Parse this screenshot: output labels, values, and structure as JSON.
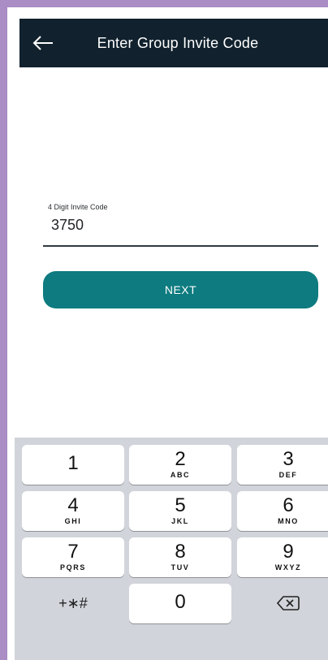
{
  "header": {
    "title": "Enter Group Invite Code",
    "back_icon": "arrow-left-icon",
    "background": "#11222e"
  },
  "invite": {
    "label": "4 Digit Invite Code",
    "value": "3750"
  },
  "next_button": {
    "label": "NEXT",
    "color": "#0d7b7f"
  },
  "keypad": {
    "keys": [
      {
        "digit": "1",
        "letters": ""
      },
      {
        "digit": "2",
        "letters": "ABC"
      },
      {
        "digit": "3",
        "letters": "DEF"
      },
      {
        "digit": "4",
        "letters": "GHI"
      },
      {
        "digit": "5",
        "letters": "JKL"
      },
      {
        "digit": "6",
        "letters": "MNO"
      },
      {
        "digit": "7",
        "letters": "PQRS"
      },
      {
        "digit": "8",
        "letters": "TUV"
      },
      {
        "digit": "9",
        "letters": "WXYZ"
      }
    ],
    "symbols": "+∗#",
    "zero": "0",
    "delete_icon": "backspace-icon"
  }
}
